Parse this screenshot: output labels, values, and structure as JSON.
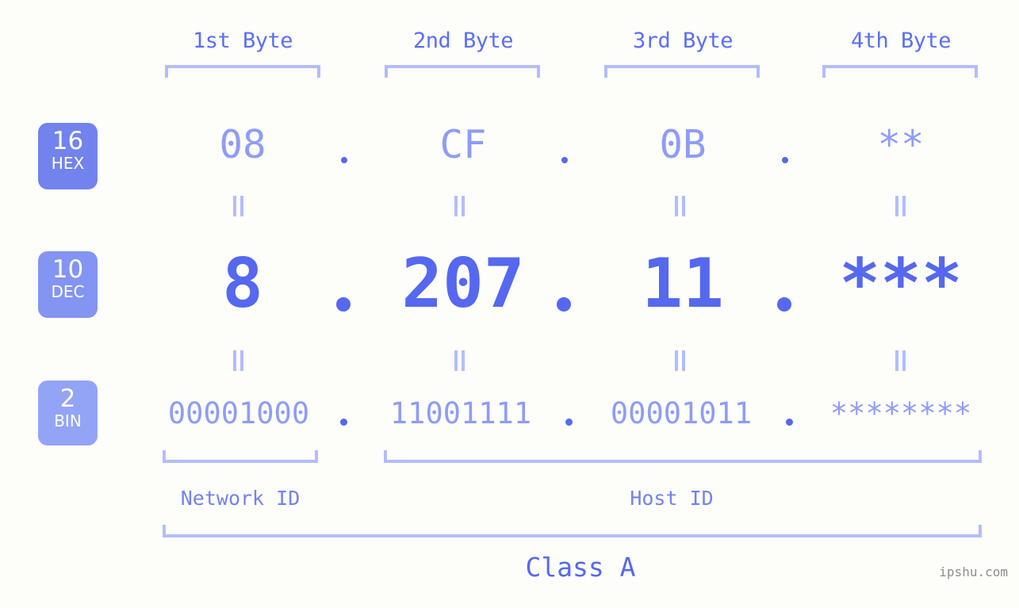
{
  "meta": {
    "watermark": "ipshu.com",
    "background_color": "#fdfdfa",
    "accent_strong": "#5568ef",
    "accent_mid": "#7283ee",
    "accent_light": "#8e9cf7",
    "accent_pale": "#b3bdfb"
  },
  "byte_headers": [
    {
      "label": "1st Byte"
    },
    {
      "label": "2nd Byte"
    },
    {
      "label": "3rd Byte"
    },
    {
      "label": "4th Byte"
    }
  ],
  "bases": [
    {
      "number": "16",
      "name": "HEX",
      "color": "#7283ee"
    },
    {
      "number": "10",
      "name": "DEC",
      "color": "#8494f2"
    },
    {
      "number": "2",
      "name": "BIN",
      "color": "#93a4f7"
    }
  ],
  "rows": {
    "hex": {
      "values": [
        "08",
        "CF",
        "0B",
        "**"
      ]
    },
    "dec": {
      "values": [
        "8",
        "207",
        "11",
        "***"
      ]
    },
    "bin": {
      "values": [
        "00001000",
        "11001111",
        "00001011",
        "********"
      ]
    }
  },
  "separators": {
    "dot": ".",
    "equals": "="
  },
  "id_sections": [
    {
      "label": "Network ID"
    },
    {
      "label": "Host ID"
    }
  ],
  "class_section": {
    "label": "Class A"
  }
}
